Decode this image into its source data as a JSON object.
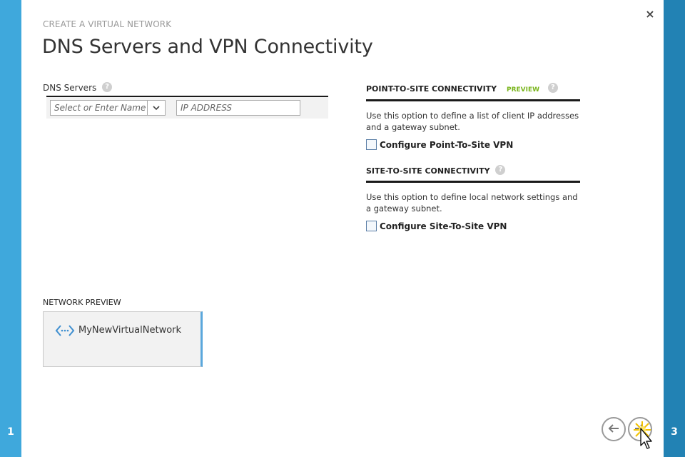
{
  "wizard": {
    "step_title": "CREATE A VIRTUAL NETWORK",
    "page_title": "DNS Servers and VPN Connectivity",
    "left_step": "1",
    "right_step": "3",
    "close": "×"
  },
  "dns": {
    "label": "DNS Servers",
    "help": "?",
    "name_placeholder": "Select or Enter Name",
    "ip_placeholder": "IP ADDRESS"
  },
  "point_to_site": {
    "heading": "POINT-TO-SITE CONNECTIVITY",
    "badge": "PREVIEW",
    "help": "?",
    "description": "Use this option to define a list of client IP addresses and a gateway subnet.",
    "checkbox_label": "Configure Point-To-Site VPN"
  },
  "site_to_site": {
    "heading": "SITE-TO-SITE CONNECTIVITY",
    "help": "?",
    "description": "Use this option to define local network settings and a gateway subnet.",
    "checkbox_label": "Configure Site-To-Site VPN"
  },
  "network_preview": {
    "label": "NETWORK PREVIEW",
    "network_name": "MyNewVirtualNetwork",
    "icon": "network-icon"
  },
  "colors": {
    "left_rail": "#3fa8dc",
    "right_rail": "#2282b4",
    "preview_badge": "#7ab51d",
    "card_accent": "#5aa7dc"
  }
}
